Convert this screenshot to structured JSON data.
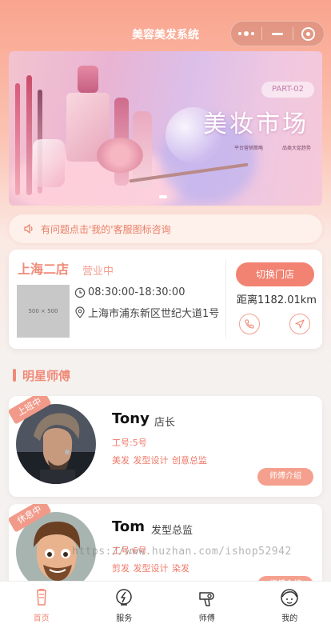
{
  "header": {
    "title": "美容美发系统"
  },
  "banner": {
    "tag": "PART-02",
    "title": "美妆市场",
    "sub_left": "平台营销策略",
    "sub_right": "品类大促趋势"
  },
  "notice": {
    "text": "有问题点击'我的'客服图标咨询"
  },
  "store": {
    "name": "上海二店",
    "status": "营业中",
    "thumb_text": "500 × 500",
    "hours": "08:30:00-18:30:00",
    "address": "上海市浦东新区世纪大道1号",
    "switch_label": "切换门店",
    "distance": "距离1182.01km"
  },
  "section": {
    "title": "明星师傅"
  },
  "masters": [
    {
      "badge": "上班中",
      "name": "Tony",
      "title": "店长",
      "id": "工号:5号",
      "skills": "美发 发型设计 创意总监",
      "intro_label": "师傅介绍"
    },
    {
      "badge": "休息中",
      "name": "Tom",
      "title": "发型总监",
      "id": "工号:6号",
      "skills": "剪发 发型设计 染发",
      "intro_label": "师傅介绍"
    }
  ],
  "watermark": "https://www.huzhan.com/ishop52942",
  "tabbar": {
    "items": [
      {
        "label": "首页",
        "icon": "home-icon",
        "active": true
      },
      {
        "label": "服务",
        "icon": "service-icon",
        "active": false
      },
      {
        "label": "师傅",
        "icon": "hairdryer-icon",
        "active": false
      },
      {
        "label": "我的",
        "icon": "profile-icon",
        "active": false
      }
    ]
  },
  "colors": {
    "accent": "#f08a78",
    "button": "#f28272",
    "header_bg": "#f9a48e"
  }
}
